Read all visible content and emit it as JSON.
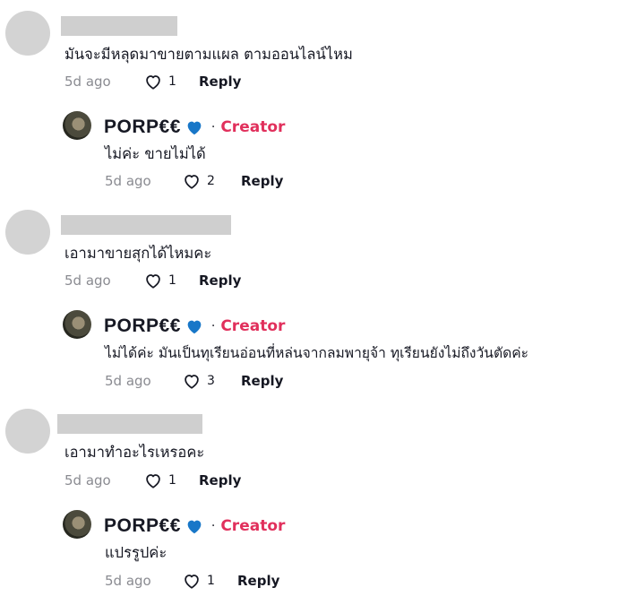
{
  "threads": [
    {
      "comment": {
        "text": "มันจะมีหลุดมาขายตามแผล ตามออนไลน์ไหม",
        "time": "5d ago",
        "likes": "1",
        "reply_label": "Reply"
      },
      "reply": {
        "name": "PORP€€",
        "badge": "Creator",
        "text": "ไม่ค่ะ ขายไม่ได้",
        "time": "5d ago",
        "likes": "2",
        "reply_label": "Reply"
      }
    },
    {
      "comment": {
        "text": "เอามาขายสุกได้ไหมคะ",
        "time": "5d ago",
        "likes": "1",
        "reply_label": "Reply"
      },
      "reply": {
        "name": "PORP€€",
        "badge": "Creator",
        "text": "ไม่ได้ค่ะ มันเป็นทุเรียนอ่อนที่หล่นจากลมพายุจ้า ทุเรียนยังไม่ถึงวันตัดค่ะ",
        "time": "5d ago",
        "likes": "3",
        "reply_label": "Reply"
      }
    },
    {
      "comment": {
        "text": "เอามาทำอะไรเหรอคะ",
        "time": "5d ago",
        "likes": "1",
        "reply_label": "Reply"
      },
      "reply": {
        "name": "PORP€€",
        "badge": "Creator",
        "text": "แปรรูปค่ะ",
        "time": "5d ago",
        "likes": "1",
        "reply_label": "Reply"
      }
    }
  ],
  "colors": {
    "creator_badge": "#e1305c",
    "verified_heart": "#1877c8",
    "muted": "#8a8b91"
  },
  "icons": {
    "like": "heart-outline-icon",
    "creator_heart": "blue-heart-icon"
  }
}
